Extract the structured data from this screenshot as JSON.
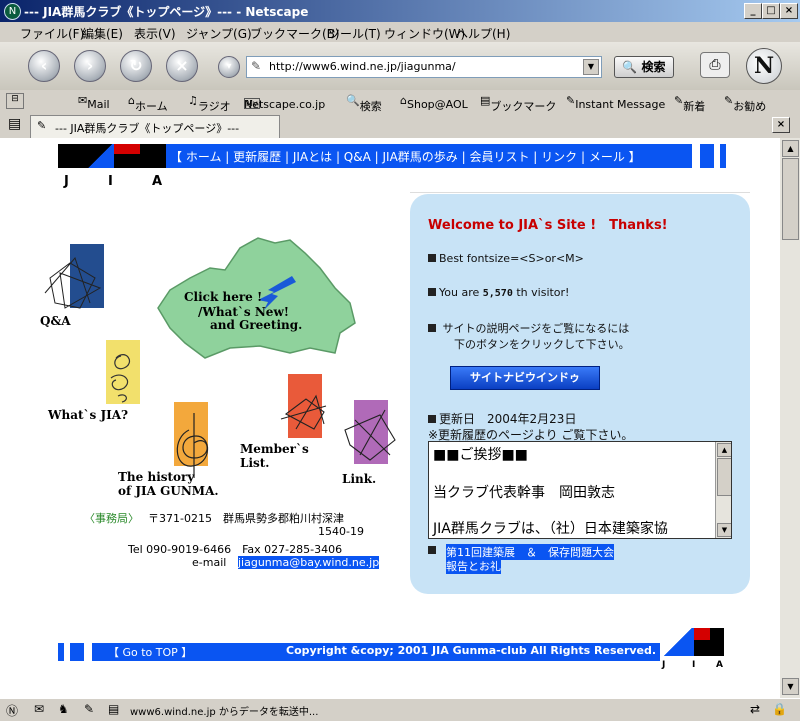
{
  "window": {
    "title": "--- JIA群馬クラブ《トップページ》--- - Netscape"
  },
  "menu": [
    "ファイル(F)",
    "編集(E)",
    "表示(V)",
    "ジャンプ(G)",
    "ブックマーク(B)",
    "ツール(T)",
    "ウィンドウ(W)",
    "ヘルプ(H)"
  ],
  "toolbar": {
    "url": "http://www6.wind.ne.jp/jiagunma/",
    "search_label": "検索",
    "logo_letter": "N"
  },
  "personal_toolbar": [
    "Mail",
    "ホーム",
    "ラジオ",
    "Netscape.co.jp",
    "検索",
    "Shop@AOL",
    "ブックマーク",
    "Instant Message",
    "新着",
    "お勧め"
  ],
  "tab": {
    "title": "--- JIA群馬クラブ《トップページ》---"
  },
  "page": {
    "logo_letters": [
      "J",
      "I",
      "A"
    ],
    "nav_items": [
      "【 ホーム",
      "更新履歴",
      "JIAとは",
      "Q&A",
      "JIA群馬の歩み",
      "会員リスト",
      "リンク",
      "メール 】"
    ],
    "map_text": [
      "Click here !",
      "/What`s New!",
      "and Greeting."
    ],
    "links": {
      "qa": "Q&A",
      "whats_jia": "What`s JIA?",
      "history_line1": "The history",
      "history_line2": "of JIA GUNMA.",
      "members_line1": "Member`s",
      "members_line2": "List.",
      "link": "Link."
    },
    "office": {
      "label": "〈事務局〉",
      "address_line1": "〒371-0215　群馬県勢多郡粕川村深津",
      "address_line2": "1540-19",
      "tel_fax": "Tel 090-9019-6466　Fax 027-285-3406",
      "email_label": "e-mail",
      "email": "jiagunma@bay.wind.ne.jp"
    },
    "welcome": {
      "title": "Welcome to JIA`s Site !　Thanks!",
      "fontsize": "Best fontsize=<S>or<M>",
      "visitor_prefix": "You are",
      "visitor_count": "5,570",
      "visitor_suffix": "th visitor!",
      "guide_line1": "サイトの説明ページをご覧になるには",
      "guide_line2": "下のボタンをクリックして下さい。",
      "navi_button": "サイトナビウインドゥ",
      "updated": "更新日　2004年2月23日",
      "history_note": "※更新履歴のページより ご覧下さい。",
      "textarea_lines": [
        "■■ご挨拶■■",
        "",
        "当クラブ代表幹事　岡田敦志",
        "",
        "JIA群馬クラブは、（社）日本建築家協"
      ],
      "news_line1": "第11回建築展　＆　保存問題大会",
      "news_line2": "報告とお礼"
    },
    "footer": {
      "go_top": "【 Go to TOP 】",
      "copyright": "Copyright &copy; 2001 JIA Gunma-club All Rights Reserved."
    }
  },
  "status": {
    "text": "www6.wind.ne.jp からデータを転送中..."
  },
  "colors": {
    "nav_blue": "#0a55f2",
    "panel_blue": "#c8e3f6",
    "welcome_red": "#c80000",
    "office_green": "#2a8a2a",
    "selection": "#0a55f2"
  }
}
